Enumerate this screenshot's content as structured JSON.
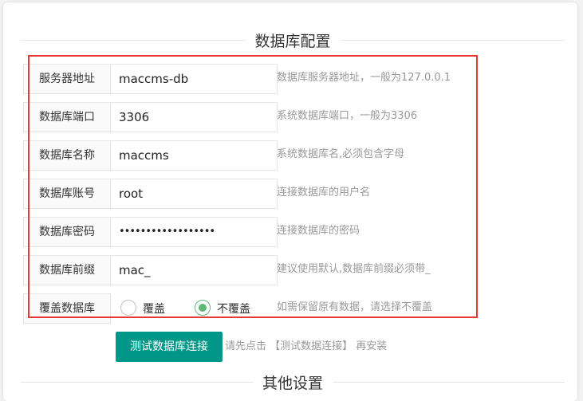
{
  "sections": {
    "db_config_title": "数据库配置",
    "other_title": "其他设置"
  },
  "fields": [
    {
      "label": "服务器地址",
      "value": "maccms-db",
      "hint": "数据库服务器地址，一般为127.0.0.1"
    },
    {
      "label": "数据库端口",
      "value": "3306",
      "hint": "系统数据库端口，一般为3306"
    },
    {
      "label": "数据库名称",
      "value": "maccms",
      "hint": "系统数据库名,必须包含字母"
    },
    {
      "label": "数据库账号",
      "value": "root",
      "hint": "连接数据库的用户名"
    },
    {
      "label": "数据库密码",
      "value": "••••••••••••••••••",
      "hint": "连接数据库的密码"
    },
    {
      "label": "数据库前缀",
      "value": "mac_",
      "hint": "建议使用默认,数据库前缀必须带_"
    }
  ],
  "overwrite": {
    "label": "覆盖数据库",
    "options": [
      {
        "label": "覆盖",
        "checked": false
      },
      {
        "label": "不覆盖",
        "checked": true
      }
    ],
    "hint": "如需保留原有数据，请选择不覆盖"
  },
  "test_button": {
    "label": "测试数据库连接",
    "tip": "请先点击 【测试数据连接】 再安装"
  },
  "colors": {
    "accent": "#009688",
    "radio_checked": "#5FB878",
    "highlight_box": "#e53935"
  }
}
